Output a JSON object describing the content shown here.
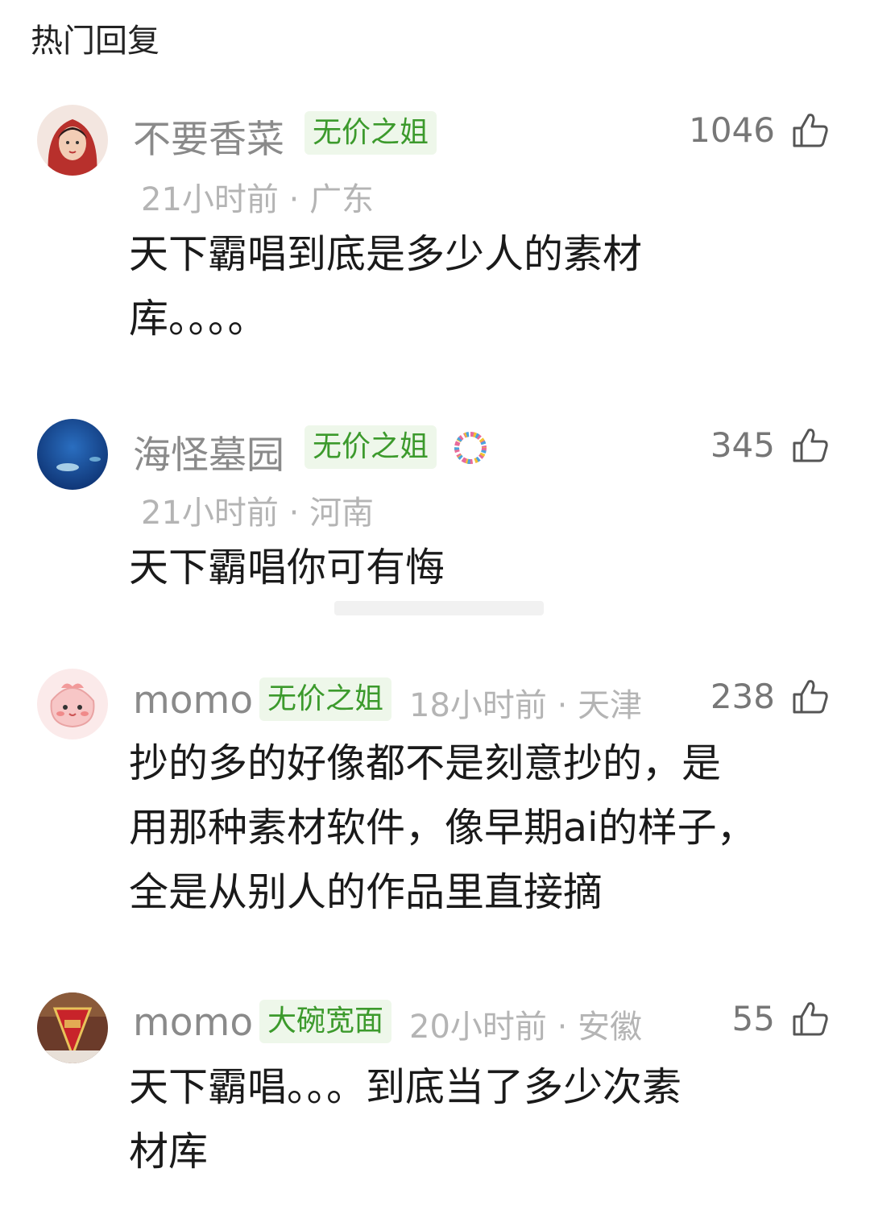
{
  "section_title": "热门回复",
  "comments": [
    {
      "name": "不要香菜",
      "badge": "无价之姐",
      "time": "21小时前",
      "sep": "·",
      "location": "广东",
      "likes": "1046",
      "lines": [
        "天下霸唱到底是多少人的素材",
        "库。。。。"
      ]
    },
    {
      "name": "海怪墓园",
      "badge": "无价之姐",
      "time": "21小时前",
      "sep": "·",
      "location": "河南",
      "likes": "345",
      "lines": [
        "天下霸唱你可有悔"
      ]
    },
    {
      "name": "momo",
      "badge": "无价之姐",
      "time": "18小时前",
      "sep": "·",
      "location": "天津",
      "likes": "238",
      "lines": [
        "抄的多的好像都不是刻意抄的，是",
        "用那种素材软件，像早期ai的样子，",
        "全是从别人的作品里直接摘"
      ]
    },
    {
      "name": "momo",
      "badge": "大碗宽面",
      "time": "20小时前",
      "sep": "·",
      "location": "安徽",
      "likes": "55",
      "lines": [
        "天下霸唱。。。到底当了多少次素",
        "材库"
      ]
    }
  ]
}
